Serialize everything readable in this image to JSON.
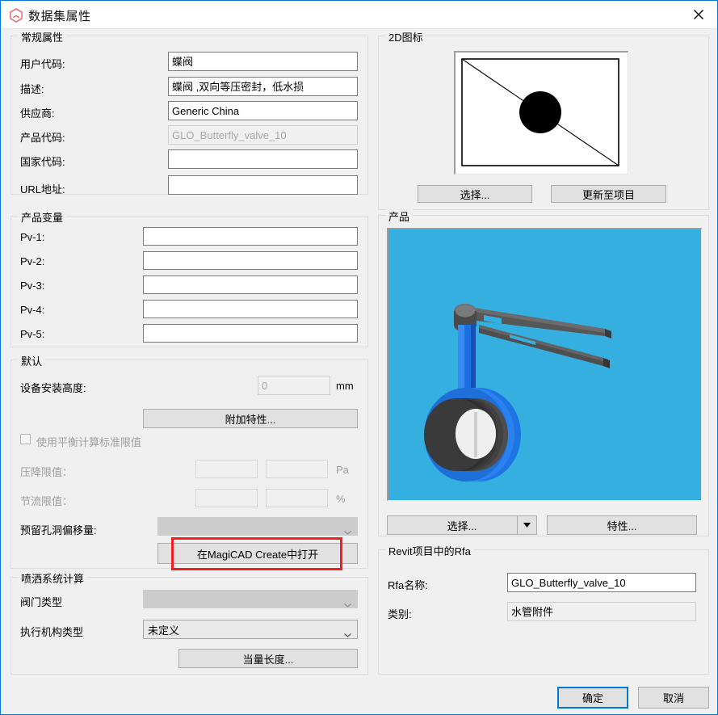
{
  "window": {
    "title": "数据集属性",
    "app_icon": "magicad-hexagon-icon",
    "close_label": "✕"
  },
  "general": {
    "legend": "常规属性",
    "fields": [
      {
        "label": "用户代码:",
        "value": "蝶阀",
        "state": "editable"
      },
      {
        "label": "描述:",
        "value": "蝶阀 ,双向等压密封，低水损",
        "state": "editable"
      },
      {
        "label": "供应商:",
        "value": "Generic China",
        "state": "editable"
      },
      {
        "label": "产品代码:",
        "value": "GLO_Butterfly_valve_10",
        "state": "readonly"
      },
      {
        "label": "国家代码:",
        "value": "",
        "state": "editable"
      },
      {
        "label": "URL地址:",
        "value": "",
        "state": "editable"
      }
    ]
  },
  "product_variables": {
    "legend": "产品变量",
    "fields": [
      {
        "label": "Pv-1:",
        "value": ""
      },
      {
        "label": "Pv-2:",
        "value": ""
      },
      {
        "label": "Pv-3:",
        "value": ""
      },
      {
        "label": "Pv-4:",
        "value": ""
      },
      {
        "label": "Pv-5:",
        "value": ""
      }
    ]
  },
  "defaults": {
    "legend": "默认",
    "install_height_label": "设备安装高度:",
    "install_height_value": "0",
    "install_height_unit": "mm",
    "additional_properties_button": "附加特性...",
    "balance_checkbox_label": "使用平衡计算标准限值",
    "balance_checkbox_checked": false,
    "pressure_drop_label": "压降限值：",
    "pressure_drop_min": "",
    "pressure_drop_max": "",
    "pressure_drop_unit": "Pa",
    "throttle_label": "节流限值：",
    "throttle_min": "",
    "throttle_max": "",
    "throttle_unit": "%",
    "reserved_hole_label": "预留孔洞偏移量:",
    "reserved_hole_value": "",
    "open_in_magicad_button": "在MagiCAD Create中打开"
  },
  "sprinkler": {
    "legend": "喷洒系统计算",
    "valve_type_label": "阀门类型",
    "valve_type_value": "",
    "actuator_type_label": "执行机构类型",
    "actuator_type_value": "未定义",
    "equivalent_length_button": "当量长度..."
  },
  "icon2d": {
    "legend": "2D图标",
    "select_button": "选择...",
    "update_button": "更新至项目",
    "graphic": "butterfly-valve-2d-symbol"
  },
  "product": {
    "legend": "产品",
    "select_button": "选择...",
    "properties_button": "特性...",
    "graphic": "butterfly-valve-3d-render",
    "background_color": "#35afe0"
  },
  "rfa": {
    "legend": "Revit项目中的Rfa",
    "name_label": "Rfa名称:",
    "name_value": "GLO_Butterfly_valve_10",
    "category_label": "类别:",
    "category_value": "水管附件"
  },
  "footer": {
    "ok_button": "确定",
    "cancel_button": "取消"
  },
  "annotation": {
    "highlight_color": "#f02020",
    "target": "在MagiCAD Create中打开"
  }
}
